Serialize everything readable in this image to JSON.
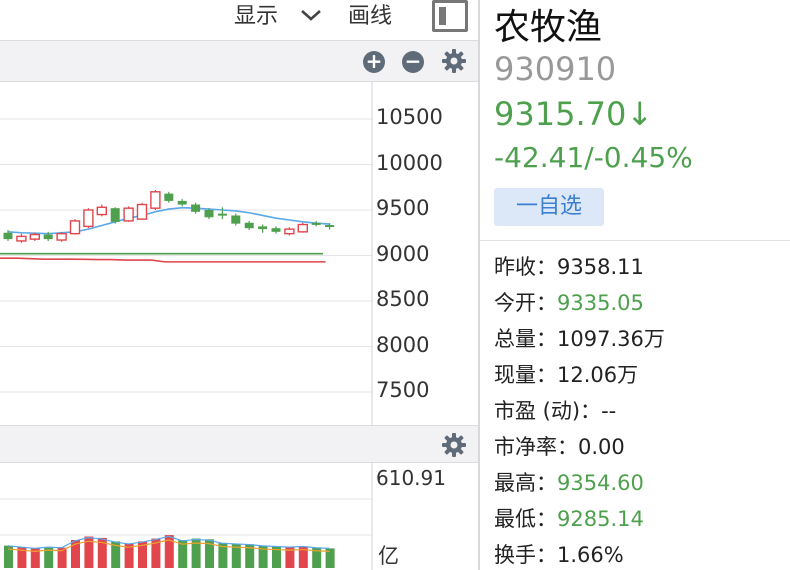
{
  "toolbar": {
    "display_label": "显示",
    "draw_label": "画线"
  },
  "kline": {
    "y_ticks": [
      "10500",
      "10000",
      "9500",
      "9000",
      "8500",
      "8000",
      "7500"
    ]
  },
  "volume": {
    "max_label": "610.91",
    "unit_label": "亿"
  },
  "quote": {
    "name": "农牧渔",
    "code": "930910",
    "price": "9315.70↓",
    "change": "-42.41/-0.45%",
    "watch_label": "一自选",
    "stats": [
      {
        "label": "昨收：",
        "value": "9358.11",
        "color": "default"
      },
      {
        "label": "今开：",
        "value": "9335.05",
        "color": "green"
      },
      {
        "label": "总量：",
        "value": "1097.36万",
        "color": "default"
      },
      {
        "label": "现量：",
        "value": "12.06万",
        "color": "default"
      },
      {
        "label": "市盈 (动)：",
        "value": "--",
        "color": "default"
      },
      {
        "label": "市净率：",
        "value": "0.00",
        "color": "default"
      },
      {
        "label": "最高：",
        "value": "9354.60",
        "color": "green"
      },
      {
        "label": "最低：",
        "value": "9285.14",
        "color": "green"
      },
      {
        "label": "换手：",
        "value": "1.66%",
        "color": "default"
      }
    ]
  },
  "colors": {
    "up": "#e0464c",
    "down": "#4ea04e",
    "ma": "#5aa8e8"
  },
  "chart_data": {
    "type": "candlestick",
    "y_axis_ticks": [
      10500,
      10000,
      9500,
      9000,
      8500,
      8000,
      7500
    ],
    "candles": [
      {
        "o": 9250,
        "c": 9180,
        "h": 9280,
        "l": 9160
      },
      {
        "o": 9160,
        "c": 9210,
        "h": 9240,
        "l": 9140
      },
      {
        "o": 9180,
        "c": 9230,
        "h": 9250,
        "l": 9160
      },
      {
        "o": 9230,
        "c": 9180,
        "h": 9260,
        "l": 9160
      },
      {
        "o": 9170,
        "c": 9240,
        "h": 9260,
        "l": 9150
      },
      {
        "o": 9240,
        "c": 9380,
        "h": 9400,
        "l": 9230
      },
      {
        "o": 9320,
        "c": 9500,
        "h": 9520,
        "l": 9300
      },
      {
        "o": 9450,
        "c": 9530,
        "h": 9560,
        "l": 9430
      },
      {
        "o": 9520,
        "c": 9370,
        "h": 9530,
        "l": 9350
      },
      {
        "o": 9380,
        "c": 9520,
        "h": 9540,
        "l": 9370
      },
      {
        "o": 9400,
        "c": 9560,
        "h": 9580,
        "l": 9390
      },
      {
        "o": 9520,
        "c": 9700,
        "h": 9720,
        "l": 9500
      },
      {
        "o": 9680,
        "c": 9600,
        "h": 9700,
        "l": 9580
      },
      {
        "o": 9600,
        "c": 9560,
        "h": 9620,
        "l": 9540
      },
      {
        "o": 9560,
        "c": 9480,
        "h": 9580,
        "l": 9460
      },
      {
        "o": 9500,
        "c": 9420,
        "h": 9520,
        "l": 9400
      },
      {
        "o": 9460,
        "c": 9440,
        "h": 9530,
        "l": 9400
      },
      {
        "o": 9440,
        "c": 9350,
        "h": 9460,
        "l": 9330
      },
      {
        "o": 9360,
        "c": 9300,
        "h": 9380,
        "l": 9280
      },
      {
        "o": 9320,
        "c": 9290,
        "h": 9340,
        "l": 9250
      },
      {
        "o": 9300,
        "c": 9260,
        "h": 9320,
        "l": 9240
      },
      {
        "o": 9240,
        "c": 9290,
        "h": 9310,
        "l": 9220
      },
      {
        "o": 9260,
        "c": 9340,
        "h": 9360,
        "l": 9250
      },
      {
        "o": 9358,
        "c": 9342,
        "h": 9380,
        "l": 9320
      },
      {
        "o": 9335,
        "c": 9316,
        "h": 9355,
        "l": 9285
      }
    ],
    "ma_line": [
      9260,
      9250,
      9245,
      9240,
      9250,
      9260,
      9290,
      9330,
      9370,
      9410,
      9440,
      9480,
      9510,
      9525,
      9520,
      9510,
      9500,
      9490,
      9470,
      9440,
      9410,
      9390,
      9370,
      9355,
      9345
    ],
    "green_level": 9020,
    "red_level": [
      8970,
      8970,
      8965,
      8960,
      8960,
      8960,
      8958,
      8955,
      8955,
      8950,
      8950,
      8950,
      8930,
      8930,
      8930,
      8930,
      8930,
      8930,
      8930,
      8930,
      8930,
      8930,
      8930,
      8930,
      8930
    ],
    "volume": [
      {
        "v": 320,
        "up": false
      },
      {
        "v": 300,
        "up": true
      },
      {
        "v": 280,
        "up": true
      },
      {
        "v": 300,
        "up": false
      },
      {
        "v": 290,
        "up": true
      },
      {
        "v": 400,
        "up": true
      },
      {
        "v": 450,
        "up": true
      },
      {
        "v": 430,
        "up": true
      },
      {
        "v": 380,
        "up": false
      },
      {
        "v": 350,
        "up": true
      },
      {
        "v": 380,
        "up": true
      },
      {
        "v": 420,
        "up": true
      },
      {
        "v": 470,
        "up": true
      },
      {
        "v": 400,
        "up": false
      },
      {
        "v": 420,
        "up": false
      },
      {
        "v": 410,
        "up": false
      },
      {
        "v": 360,
        "up": false
      },
      {
        "v": 350,
        "up": false
      },
      {
        "v": 340,
        "up": false
      },
      {
        "v": 320,
        "up": false
      },
      {
        "v": 310,
        "up": false
      },
      {
        "v": 300,
        "up": true
      },
      {
        "v": 310,
        "up": true
      },
      {
        "v": 290,
        "up": false
      },
      {
        "v": 280,
        "up": false
      }
    ]
  }
}
